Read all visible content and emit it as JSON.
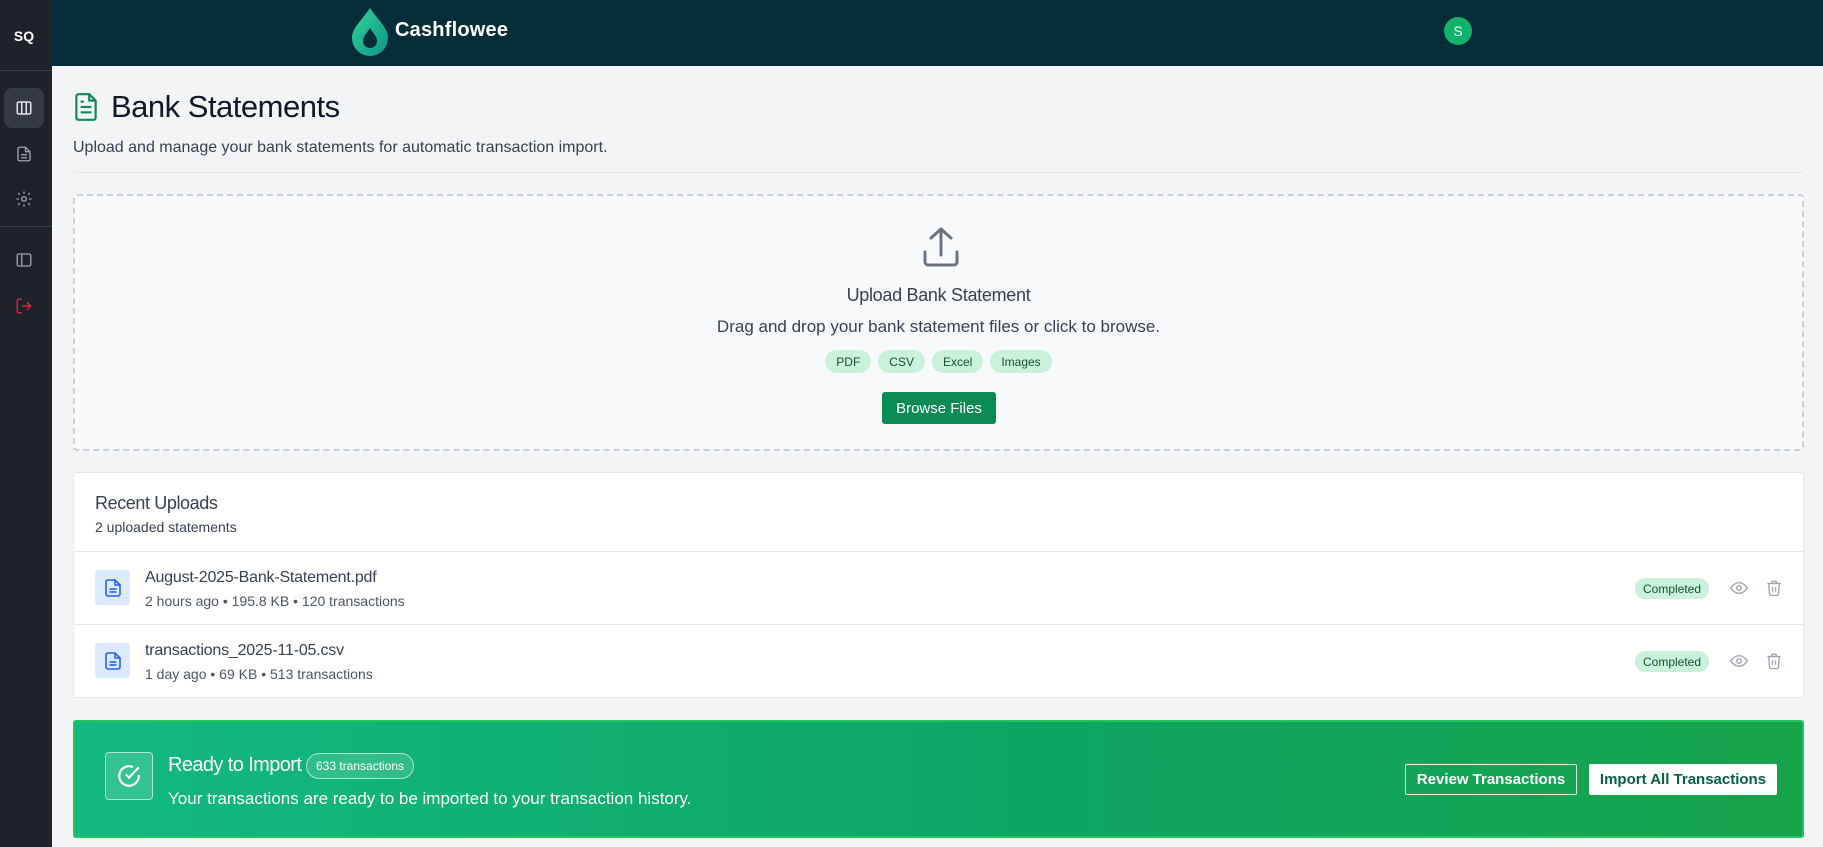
{
  "sidebar": {
    "avatar_initials": "SQ",
    "items": [
      {
        "icon": "columns-icon",
        "active": true
      },
      {
        "icon": "document-icon",
        "active": false
      },
      {
        "icon": "gear-icon",
        "active": false
      },
      {
        "icon": "panel-toggle-icon",
        "active": false
      },
      {
        "icon": "logout-icon",
        "active": false
      }
    ]
  },
  "header": {
    "brand": "Cashflowee",
    "user_initial": "S"
  },
  "page": {
    "title": "Bank Statements",
    "subtitle": "Upload and manage your bank statements for automatic transaction import."
  },
  "dropzone": {
    "title": "Upload Bank Statement",
    "description": "Drag and drop your bank statement files or click to browse.",
    "formats": [
      "PDF",
      "CSV",
      "Excel",
      "Images"
    ],
    "browse_label": "Browse Files"
  },
  "uploads": {
    "title": "Recent Uploads",
    "count_text": "2 uploaded statements",
    "rows": [
      {
        "name": "August-2025-Bank-Statement.pdf",
        "meta": "2 hours ago • 195.8 KB • 120 transactions",
        "status": "Completed"
      },
      {
        "name": "transactions_2025-11-05.csv",
        "meta": "1 day ago • 69 KB • 513 transactions",
        "status": "Completed"
      }
    ]
  },
  "banner": {
    "title": "Ready to Import",
    "badge": "633 transactions",
    "description": "Your transactions are ready to be imported to your transaction history.",
    "review_label": "Review Transactions",
    "import_label": "Import All Transactions"
  },
  "colors": {
    "brand_green": "#0b8a54",
    "header_bg": "#052e3a",
    "sidebar_bg": "#1f2329",
    "logout_red": "#e11d48"
  }
}
